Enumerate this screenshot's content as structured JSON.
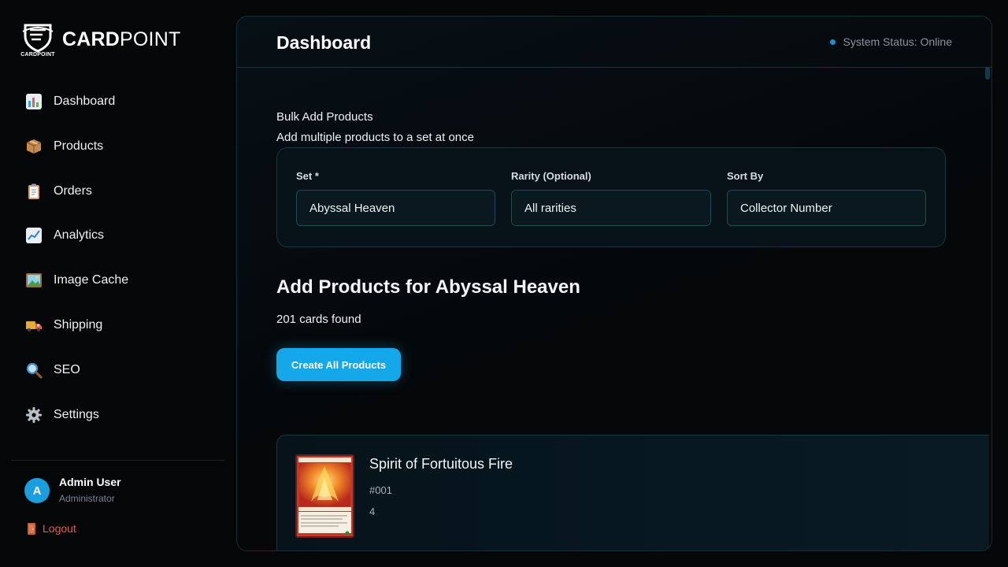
{
  "brand": {
    "logo_sub": "CARDPOINT",
    "name_bold": "CARD",
    "name_light": "POINT"
  },
  "nav": [
    {
      "label": "Dashboard",
      "icon": "bar-chart-icon"
    },
    {
      "label": "Products",
      "icon": "package-icon"
    },
    {
      "label": "Orders",
      "icon": "clipboard-icon"
    },
    {
      "label": "Analytics",
      "icon": "line-chart-icon"
    },
    {
      "label": "Image Cache",
      "icon": "picture-icon"
    },
    {
      "label": "Shipping",
      "icon": "truck-icon"
    },
    {
      "label": "SEO",
      "icon": "magnifier-icon"
    },
    {
      "label": "Settings",
      "icon": "gear-icon"
    }
  ],
  "user": {
    "initial": "A",
    "name": "Admin User",
    "role": "Administrator"
  },
  "logout": {
    "label": "Logout"
  },
  "header": {
    "title": "Dashboard",
    "status": "System Status: Online"
  },
  "bulk": {
    "title": "Bulk Add Products",
    "subtitle": "Add multiple products to a set at once",
    "fields": [
      {
        "label": "Set *",
        "value": "Abyssal Heaven"
      },
      {
        "label": "Rarity (Optional)",
        "value": "All rarities"
      },
      {
        "label": "Sort By",
        "value": "Collector Number"
      }
    ]
  },
  "products": {
    "heading": "Add Products for Abyssal Heaven",
    "count_text": "201 cards found",
    "create_label": "Create All Products"
  },
  "card": {
    "name": "Spirit of Fortuitous Fire",
    "number": "#001",
    "qty": "4"
  },
  "colors": {
    "accent": "#14a7ea",
    "status": "#1b8fd0",
    "logout": "#e05a57",
    "background": "#050607"
  }
}
